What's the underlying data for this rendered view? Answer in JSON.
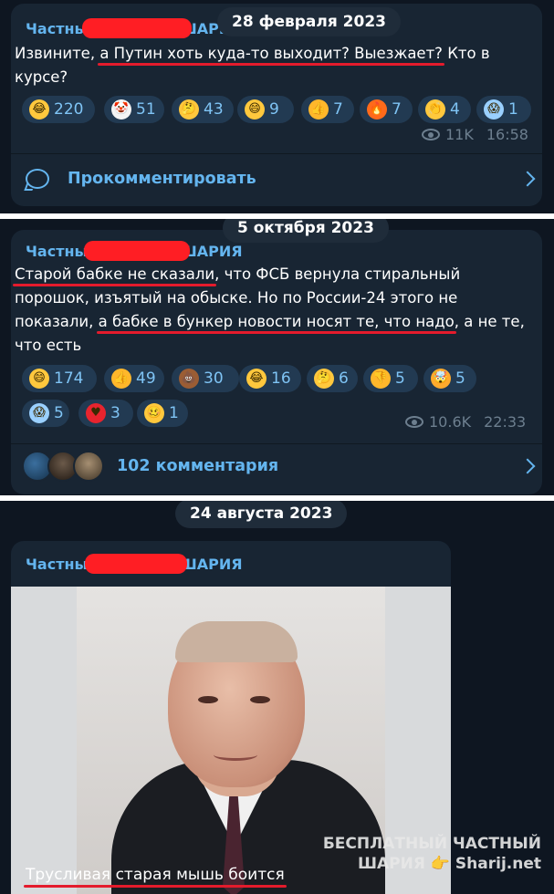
{
  "posts": [
    {
      "date": "28 февраля 2023",
      "author_left": "Частны",
      "author_right": "ШАРИЯ",
      "text_before": "Извините, ",
      "text_underlined": "а Путин хоть куда-то выходит? Выезжает?",
      "text_after": " Кто в курсе?",
      "reactions": [
        {
          "icon": "rofl-emoji-icon",
          "count": "220"
        },
        {
          "icon": "clown-emoji-icon",
          "count": "51"
        },
        {
          "icon": "thinking-emoji-icon",
          "count": "43"
        },
        {
          "icon": "grin-emoji-icon",
          "count": "9"
        },
        {
          "icon": "thumbs-up-emoji-icon",
          "count": "7"
        },
        {
          "icon": "fire-emoji-icon",
          "count": "7"
        },
        {
          "icon": "clap-emoji-icon",
          "count": "4"
        },
        {
          "icon": "scream-emoji-icon",
          "count": "1"
        }
      ],
      "views": "11K",
      "time": "16:58",
      "comment_label": "Прокомментировать"
    },
    {
      "date": "5 октября 2023",
      "author_left": "Частны",
      "author_right": "ШАРИЯ",
      "seg1_u": "Старой бабке не сказали",
      "seg2": ", что ФСБ вернула стиральный порошок, изъятый на обыске. Но по России-24 этого не показали, ",
      "seg3_u": "а бабке в бункер новости носят те, что надо",
      "seg4": ", а не те, что есть",
      "reactions": [
        {
          "icon": "grin-emoji-icon",
          "count": "174"
        },
        {
          "icon": "thumbs-up-emoji-icon",
          "count": "49"
        },
        {
          "icon": "poop-emoji-icon",
          "count": "30"
        },
        {
          "icon": "rofl-emoji-icon",
          "count": "16"
        },
        {
          "icon": "thinking-emoji-icon",
          "count": "6"
        },
        {
          "icon": "thumbs-down-emoji-icon",
          "count": "5"
        },
        {
          "icon": "exploding-head-emoji-icon",
          "count": "5"
        },
        {
          "icon": "scream-emoji-icon",
          "count": "5"
        },
        {
          "icon": "heart-emoji-icon",
          "count": "3"
        },
        {
          "icon": "woozy-emoji-icon",
          "count": "1"
        }
      ],
      "views": "10.6K",
      "time": "22:33",
      "comment_label": "102 комментария"
    },
    {
      "date": "24 августа 2023",
      "author_left": "Частны",
      "author_right": "ШАРИЯ",
      "caption": "Трусливая старая мышь боится",
      "watermark_line1": "БЕСПЛАТНЫЙ ЧАСТНЫЙ",
      "watermark_line2": "ШАРИЯ 👉 Sharij.net"
    }
  ],
  "colors": {
    "accent": "#64b5ef",
    "background": "#0e1621",
    "bubble": "#182533",
    "redaction": "#ff1e24",
    "underline": "#e41b2c"
  }
}
